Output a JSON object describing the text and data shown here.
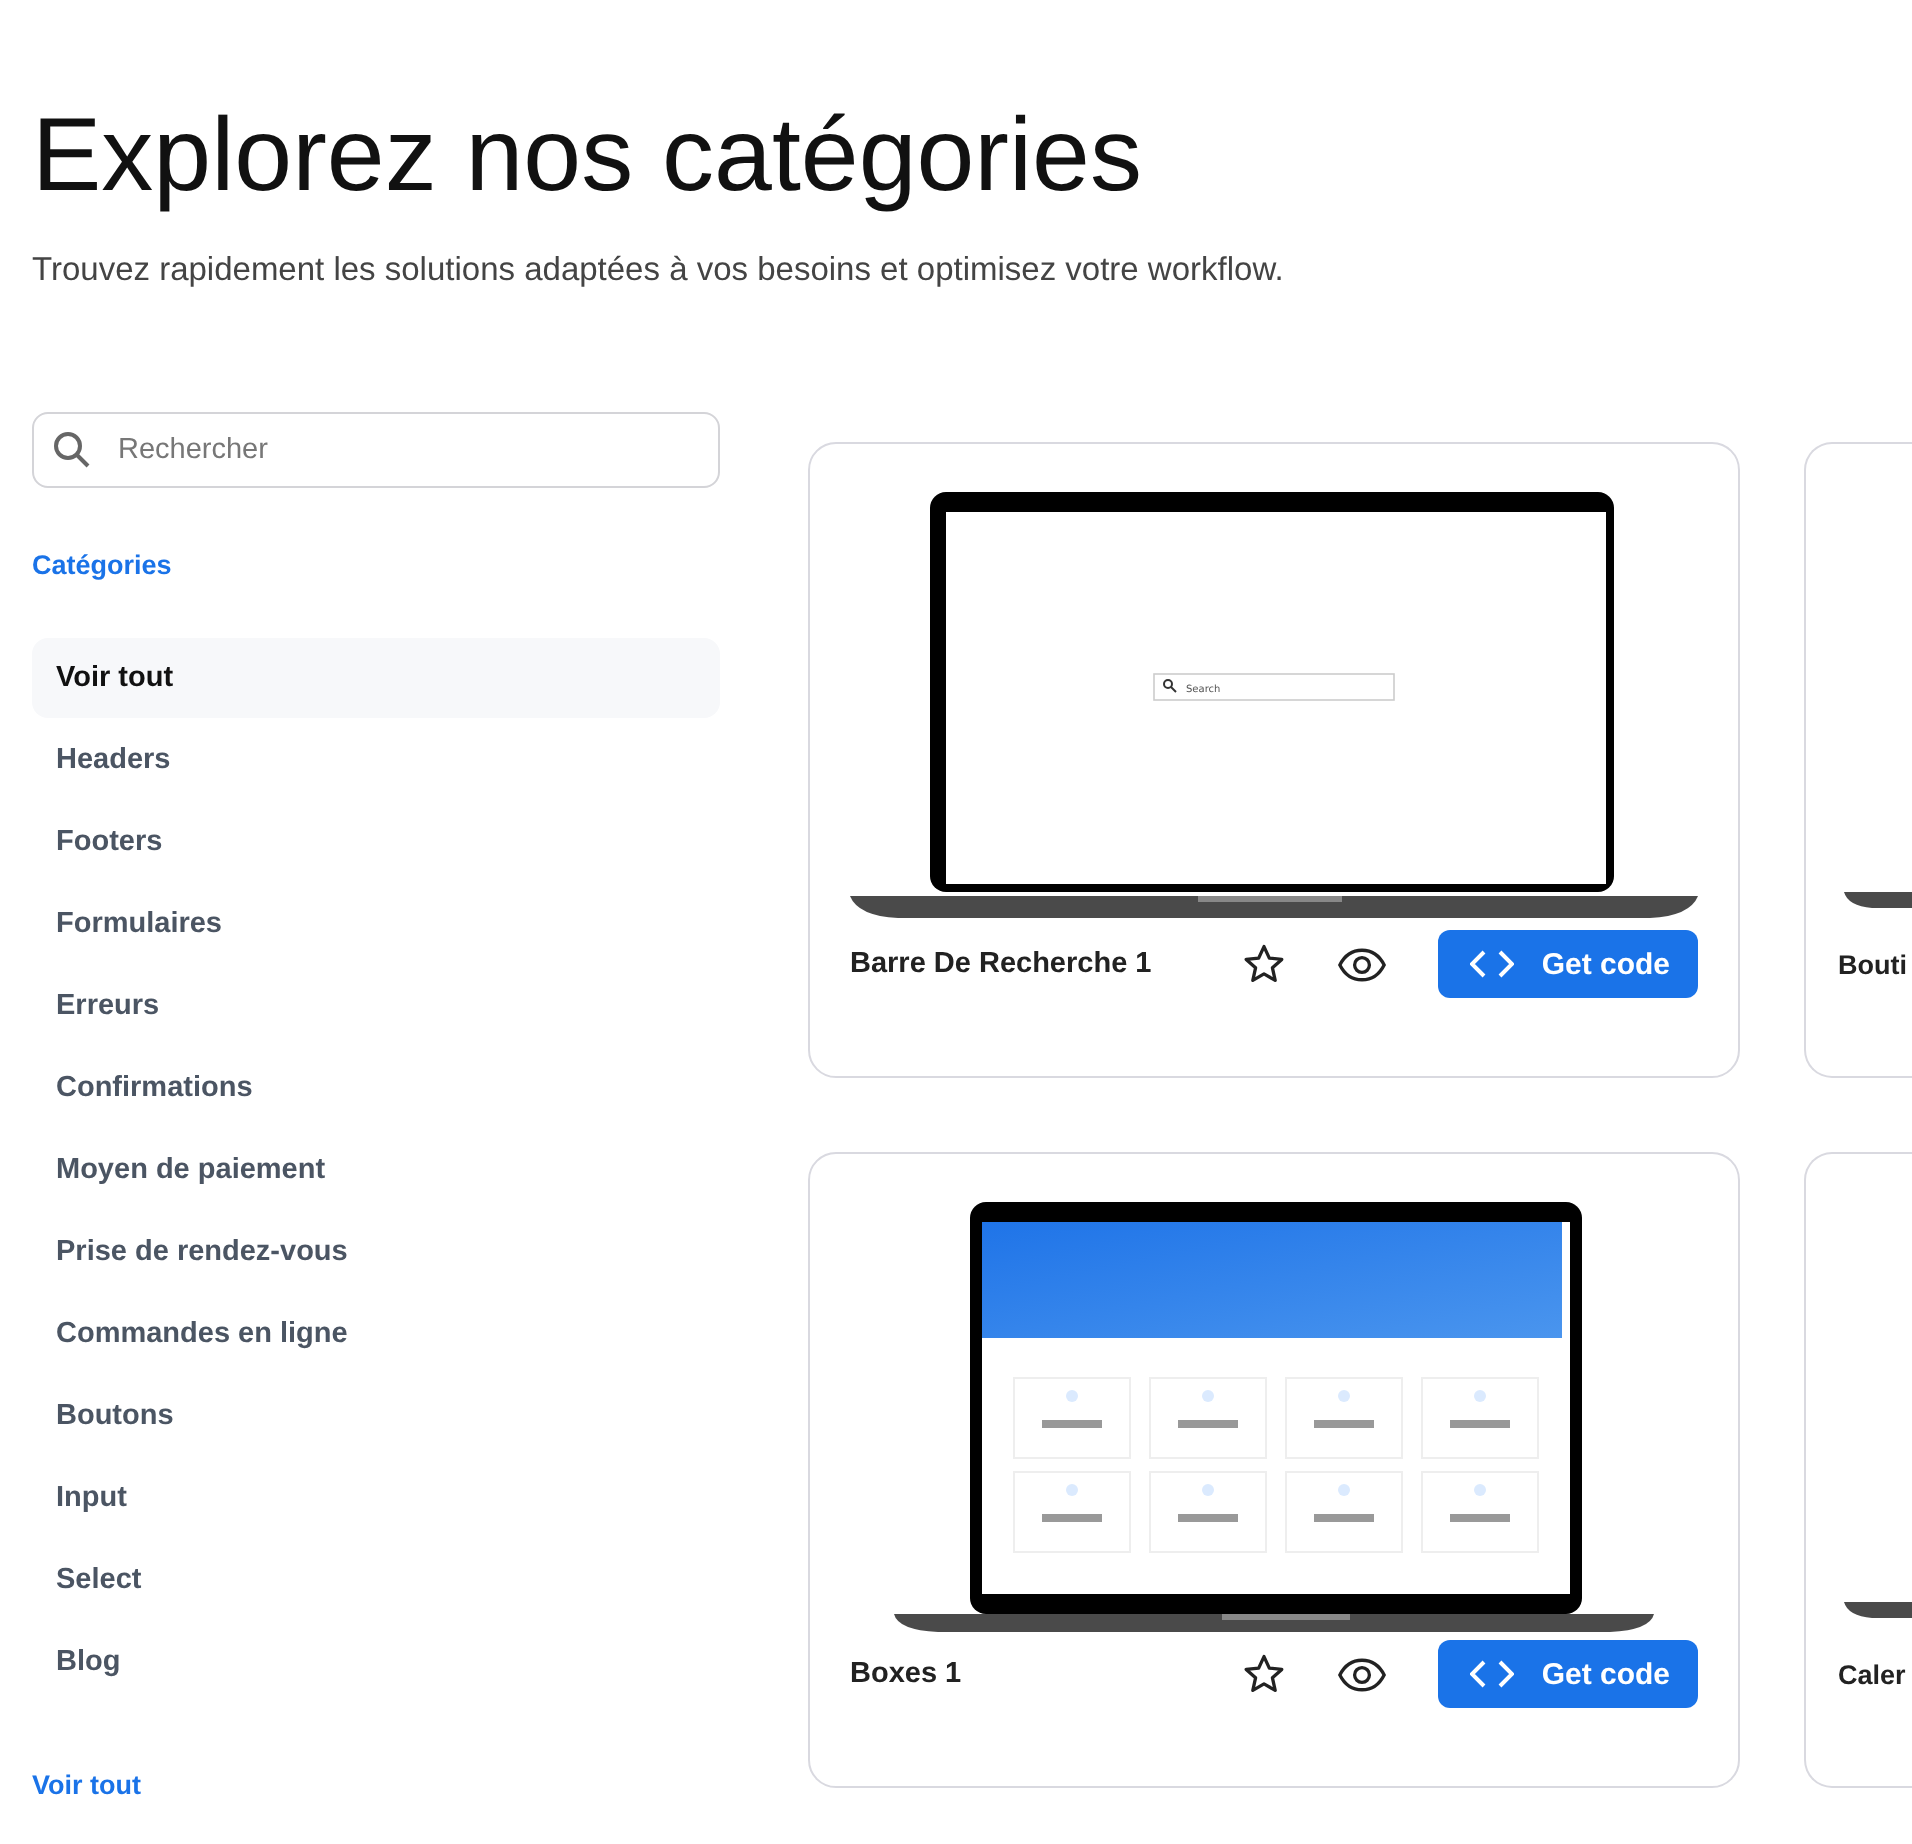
{
  "header": {
    "title": "Explorez nos catégories",
    "subtitle": "Trouvez rapidement les solutions adaptées à vos besoins et optimisez votre workflow."
  },
  "sidebar": {
    "search": {
      "placeholder": "Rechercher"
    },
    "heading": "Catégories",
    "items": [
      {
        "label": "Voir tout",
        "selected": true
      },
      {
        "label": "Headers",
        "selected": false
      },
      {
        "label": "Footers",
        "selected": false
      },
      {
        "label": "Formulaires",
        "selected": false
      },
      {
        "label": "Erreurs",
        "selected": false
      },
      {
        "label": "Confirmations",
        "selected": false
      },
      {
        "label": "Moyen de paiement",
        "selected": false
      },
      {
        "label": "Prise de rendez-vous",
        "selected": false
      },
      {
        "label": "Commandes en ligne",
        "selected": false
      },
      {
        "label": "Boutons",
        "selected": false
      },
      {
        "label": "Input",
        "selected": false
      },
      {
        "label": "Select",
        "selected": false
      },
      {
        "label": "Blog",
        "selected": false
      }
    ],
    "footer_link": "Voir tout"
  },
  "cards": [
    {
      "title": "Barre De Recherche 1",
      "kind": "search-bar",
      "preview_text": "Search",
      "button": "Get code"
    },
    {
      "title": "Bouti",
      "kind": "cropped"
    },
    {
      "title": "Boxes 1",
      "kind": "boxes",
      "button": "Get code"
    },
    {
      "title": "Caler",
      "kind": "cropped"
    }
  ]
}
